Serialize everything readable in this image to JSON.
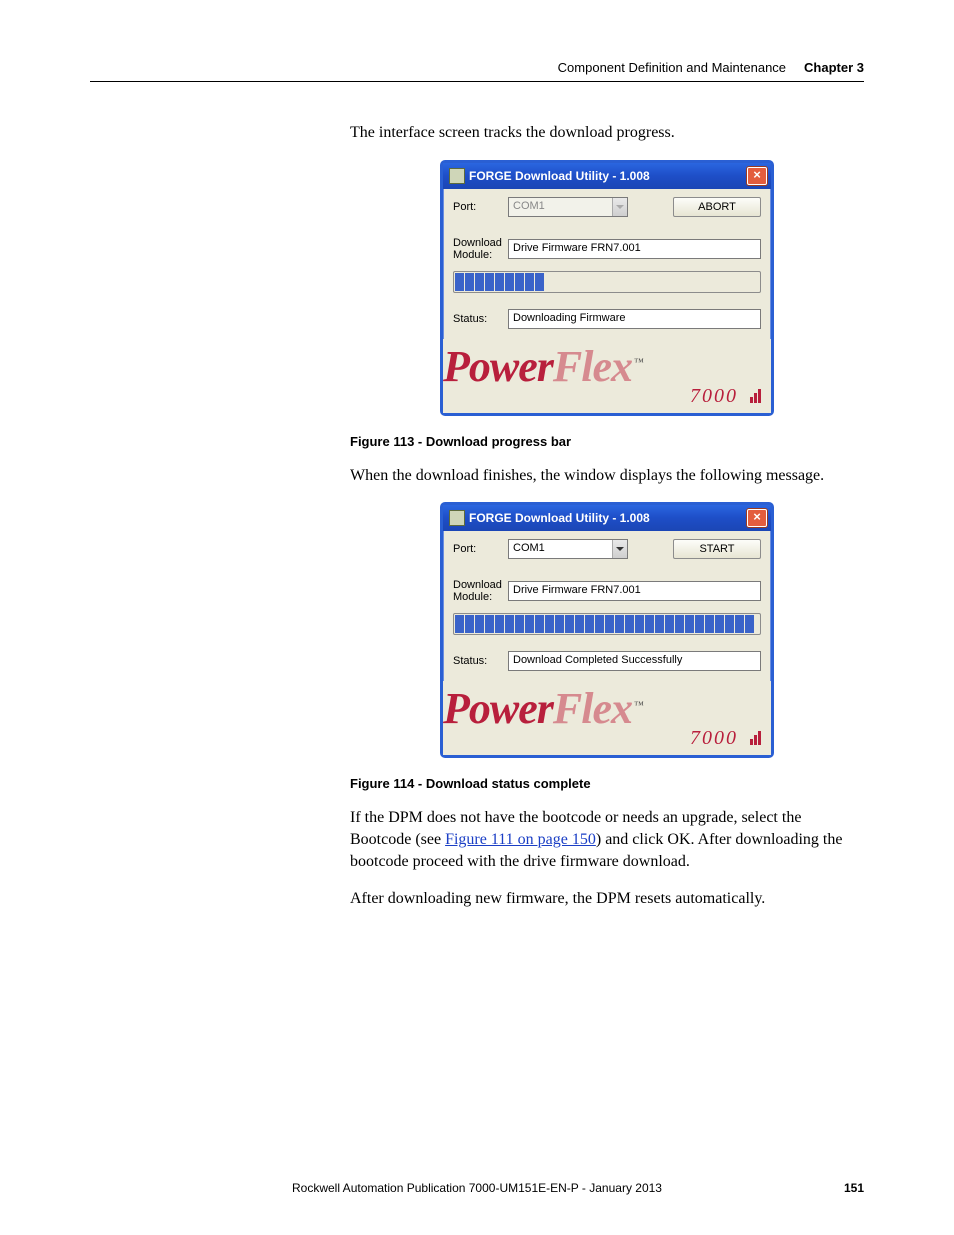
{
  "header": {
    "section": "Component Definition and Maintenance",
    "chapter": "Chapter 3"
  },
  "text": {
    "intro": "The interface screen tracks the download progress.",
    "fig113_caption": "Figure 113 - Download progress bar",
    "mid": "When the download finishes, the window displays the following message.",
    "fig114_caption": "Figure 114 - Download status complete",
    "para2a": "If the DPM does not have the bootcode or needs an upgrade, select the Bootcode (see ",
    "para2_link": "Figure 111 on page 150",
    "para2b": ") and click OK. After downloading the bootcode proceed with the drive firmware download.",
    "para3": "After downloading new firmware, the DPM resets automatically."
  },
  "dialog1": {
    "title": "FORGE Download Utility - 1.008",
    "port_label": "Port:",
    "port_value": "COM1",
    "button": "ABORT",
    "module_label": "Download Module:",
    "module_value": "Drive Firmware FRN7.001",
    "status_label": "Status:",
    "status_value": "Downloading Firmware",
    "progress_filled": 9,
    "progress_total": 30,
    "port_disabled": true
  },
  "dialog2": {
    "title": "FORGE Download Utility - 1.008",
    "port_label": "Port:",
    "port_value": "COM1",
    "button": "START",
    "module_label": "Download Module:",
    "module_value": "Drive Firmware FRN7.001",
    "status_label": "Status:",
    "status_value": "Download Completed Successfully",
    "progress_filled": 30,
    "progress_total": 30,
    "port_disabled": false
  },
  "logo": {
    "power": "Power",
    "flex": "Flex",
    "tm": "™",
    "sub": "7000"
  },
  "footer": {
    "pub": "Rockwell Automation Publication 7000-UM151E-EN-P - January 2013",
    "page": "151"
  }
}
